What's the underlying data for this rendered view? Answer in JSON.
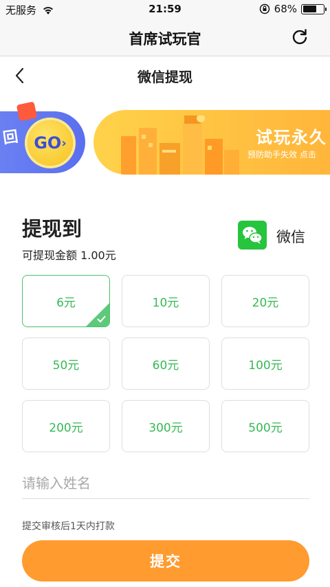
{
  "status_bar": {
    "carrier": "无服务",
    "time": "21:59",
    "battery_text": "68%",
    "battery_level": 0.68
  },
  "app_header": {
    "title": "首席试玩官",
    "refresh_icon": "refresh-icon"
  },
  "page_header": {
    "title": "微信提现",
    "back_icon": "chevron-left-icon"
  },
  "banner": {
    "left_text": "回",
    "go_label": "GO",
    "title": "试玩永久",
    "subtitle": "预防助手失效 点击"
  },
  "withdraw": {
    "title": "提现到",
    "available_amount": "可提现金额 1.00元",
    "method_label": "微信",
    "method_icon": "wechat-icon"
  },
  "amount_options": [
    {
      "label": "6元",
      "selected": true
    },
    {
      "label": "10元",
      "selected": false
    },
    {
      "label": "20元",
      "selected": false
    },
    {
      "label": "50元",
      "selected": false
    },
    {
      "label": "60元",
      "selected": false
    },
    {
      "label": "100元",
      "selected": false
    },
    {
      "label": "200元",
      "selected": false
    },
    {
      "label": "300元",
      "selected": false
    },
    {
      "label": "500元",
      "selected": false
    }
  ],
  "form": {
    "name_placeholder": "请输入姓名",
    "name_value": ""
  },
  "notice": "提交审核后1天内打款",
  "submit_label": "提交",
  "colors": {
    "accent_green": "#35b955",
    "submit_orange": "#ff9b2f",
    "wechat_green": "#27c43d"
  }
}
